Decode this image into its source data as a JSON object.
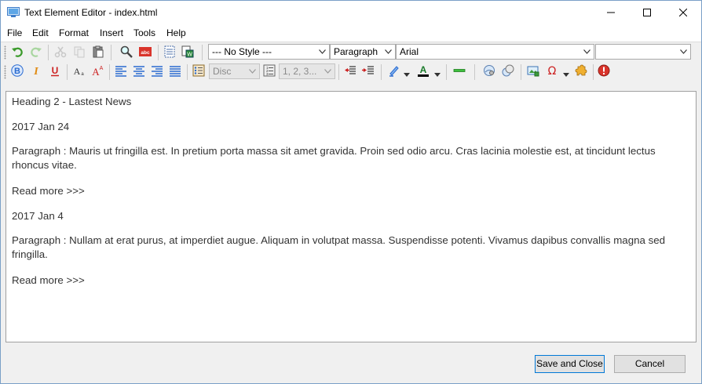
{
  "window": {
    "title": "Text Element Editor - index.html",
    "minimize": "—",
    "maximize": "☐",
    "close": "✕"
  },
  "menu": [
    "File",
    "Edit",
    "Format",
    "Insert",
    "Tools",
    "Help"
  ],
  "toolbar": {
    "style_select": "--- No Style ---",
    "block_select": "Paragraph",
    "font_select": "Arial",
    "size_select": "",
    "list_style_select": "Disc",
    "numbering_select": "1, 2, 3..."
  },
  "content": {
    "heading": "Heading 2 - Lastest News",
    "date1": "2017 Jan 24",
    "para1": "Paragraph : Mauris ut fringilla est. In pretium porta massa sit amet gravida. Proin sed odio arcu. Cras lacinia molestie est, at tincidunt lectus rhoncus vitae.",
    "link1": "Read more >>>",
    "date2": "2017 Jan 4",
    "para2": "Paragraph : Nullam at erat purus, at imperdiet augue. Aliquam in volutpat massa. Suspendisse potenti. Vivamus dapibus convallis magna sed fringilla.",
    "link2": "Read more >>>"
  },
  "footer": {
    "save_close": "Save and Close",
    "cancel": "Cancel"
  },
  "colors": {
    "accent": "#0078d7",
    "undo_green": "#3a9a2a",
    "bold_blue": "#2a6bd0",
    "italic_orange": "#e08a10",
    "underline_red": "#cc2020"
  }
}
